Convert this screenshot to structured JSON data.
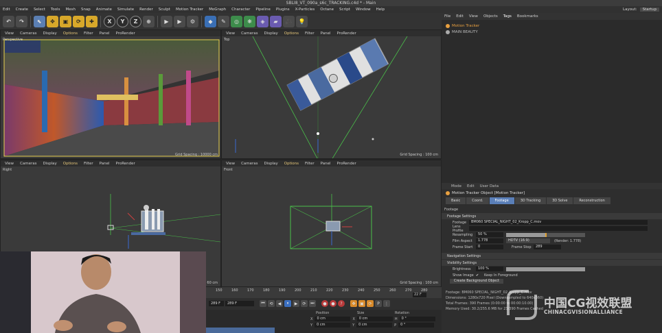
{
  "window": {
    "title": "SBLI8_VT_090a_s6c_TRACKING.c4d * - Main"
  },
  "menubar": {
    "items": [
      "Edit",
      "Create",
      "Select",
      "Tools",
      "Mesh",
      "Snap",
      "Animate",
      "Simulate",
      "Render",
      "Sculpt",
      "Motion Tracker",
      "MoGraph",
      "Character",
      "Pipeline",
      "Plugins",
      "X-Particles",
      "Octane",
      "Script",
      "Window",
      "Help"
    ],
    "layout_label": "Layout:",
    "layout_value": "Startup"
  },
  "toolbar": {
    "axis_x": "X",
    "axis_y": "Y",
    "axis_z": "Z"
  },
  "viewports": {
    "menu": [
      "View",
      "Cameras",
      "Display",
      "Options",
      "Filter",
      "Panel",
      "ProRender"
    ],
    "perspective": {
      "label": "Perspective",
      "grid": "Grid Spacing : 10000 cm"
    },
    "top": {
      "label": "Top",
      "grid": "Grid Spacing : 100 cm"
    },
    "right": {
      "label": "Right",
      "grid": "60 cm"
    },
    "front": {
      "label": "Front",
      "grid": "Grid Spacing : 100 cm"
    }
  },
  "object_manager": {
    "tabs": [
      "File",
      "Edit",
      "View",
      "Objects",
      "Tags",
      "Bookmarks"
    ],
    "objects": [
      {
        "name": "Motion Tracker",
        "color": "#e8a040"
      },
      {
        "name": "MAIN BEAUTY",
        "color": "#bdbdbd"
      }
    ]
  },
  "attributes": {
    "menu": [
      "Mode",
      "Edit",
      "User Data"
    ],
    "title": "Motion Tracker Object [Motion Tracker]",
    "tabs": [
      "Basic",
      "Coord.",
      "Footage",
      "3D Tracking",
      "3D Solve",
      "Reconstruction"
    ],
    "active_tab": "Footage",
    "section_footage": "Footage",
    "section_footage_settings": "Footage Settings",
    "footage_label": "Footage",
    "footage_value": "BM060 SPECIAL_NIGHT_02_Kropp_C.mov",
    "lens_profile_label": "Lens Profile",
    "resampling_label": "Resampling",
    "resampling_value": "50 %",
    "resampling_fraction": 0.5,
    "film_aspect_label": "Film Aspect",
    "film_aspect_value": "1.778",
    "film_aspect_preset": "HDTV (16:9)",
    "film_aspect_render": "(Render: 1.778)",
    "frame_start_label": "Frame Start",
    "frame_start_value": "0",
    "frame_stop_label": "Frame Stop",
    "frame_stop_value": "289",
    "section_navigation": "Navigation Settings",
    "section_visibility": "Visibility Settings",
    "brightness_label": "Brightness",
    "brightness_value": "100 %",
    "show_image_label": "Show Image",
    "keep_label": "Keep In Foreground",
    "create_bg_label": "Create Background Object",
    "info_footage": "Footage: BM060 SPECIAL_NIGHT_02_Kropp_C.mov",
    "info_dimensions": "Dimensions: 1280x720 Pixel (Downsampled to 640x360)",
    "info_total": "Total Frames: 390 Frames (0:00:00 to 00:00:10.00)",
    "info_memory": "Memory Used: 30.2/255.6 MB for 23/390 Frames Cached"
  },
  "timeline": {
    "ticks": [
      "150",
      "160",
      "170",
      "180",
      "190",
      "200",
      "210",
      "220",
      "230",
      "240",
      "250",
      "260",
      "270",
      "280"
    ],
    "current_frame": "22 F",
    "field_start": "289 F",
    "field_end": "289 F"
  },
  "coordinates": {
    "col_position": "Position",
    "col_size": "Size",
    "col_rotation": "Rotation",
    "x_pos": "0 cm",
    "x_size": "0 cm",
    "h_rot": "0 °",
    "y_pos": "0 cm",
    "y_size": "0 cm",
    "p_rot": "0 °"
  },
  "watermark": {
    "cn": "中国CG视效联盟",
    "en": "CHINACGVISIONALLIANCE"
  }
}
